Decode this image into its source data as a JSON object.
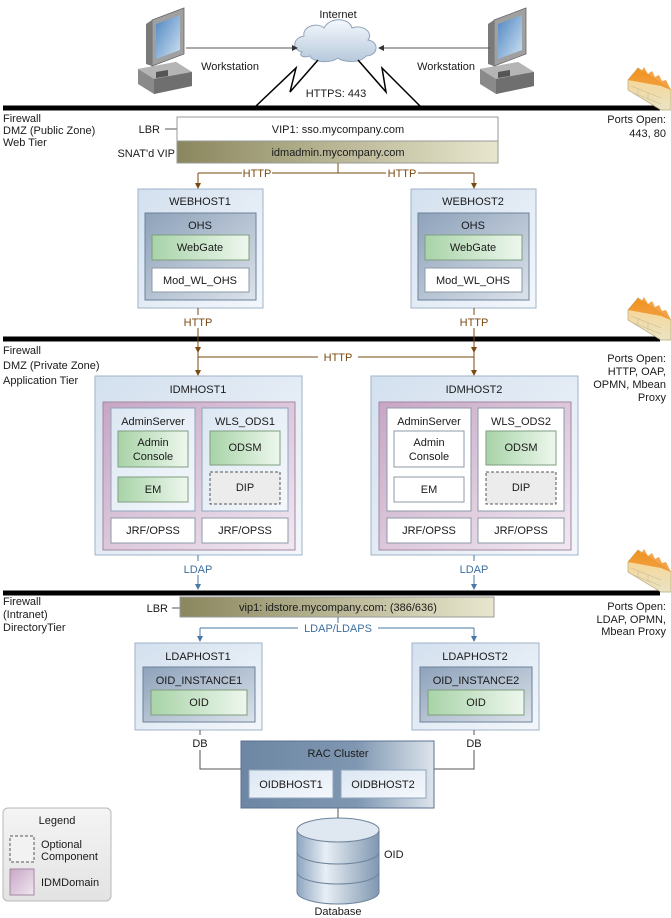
{
  "top": {
    "internet": "Internet",
    "workstation_left": "Workstation",
    "workstation_right": "Workstation",
    "https": "HTTPS: 443"
  },
  "zones": {
    "web": {
      "lines": [
        "Firewall",
        "DMZ (Public Zone)",
        "Web Tier"
      ],
      "ports": [
        "Ports Open:",
        "443, 80"
      ]
    },
    "app": {
      "lines": [
        "Firewall",
        "DMZ (Private Zone)",
        "Application Tier"
      ],
      "ports": [
        "Ports Open:",
        "HTTP, OAP,",
        "OPMN, Mbean",
        "Proxy"
      ]
    },
    "dir": {
      "lines": [
        "Firewall",
        "(Intranet)",
        "DirectoryTier"
      ],
      "ports": [
        "Ports Open:",
        "LDAP, OPMN,",
        "Mbean Proxy"
      ]
    }
  },
  "web_tier": {
    "lbr_label": "LBR",
    "vip1": "VIP1: sso.mycompany.com",
    "snat_label": "SNAT'd VIP",
    "snat_vip": "idmadmin.mycompany.com",
    "http": "HTTP",
    "hosts": [
      {
        "name": "WEBHOST1",
        "ohs": "OHS",
        "webgate": "WebGate",
        "mod": "Mod_WL_OHS"
      },
      {
        "name": "WEBHOST2",
        "ohs": "OHS",
        "webgate": "WebGate",
        "mod": "Mod_WL_OHS"
      }
    ]
  },
  "app_tier": {
    "http": "HTTP",
    "ldap": "LDAP",
    "hosts": [
      {
        "name": "IDMHOST1",
        "admin": "AdminServer",
        "admin_console": [
          "Admin",
          "Console"
        ],
        "em": "EM",
        "wls": "WLS_ODS1",
        "odsm": "ODSM",
        "dip": "DIP",
        "jrf1": "JRF/OPSS",
        "jrf2": "JRF/OPSS"
      },
      {
        "name": "IDMHOST2",
        "admin": "AdminServer",
        "admin_console": [
          "Admin",
          "Console"
        ],
        "em": "EM",
        "wls": "WLS_ODS2",
        "odsm": "ODSM",
        "dip": "DIP",
        "jrf1": "JRF/OPSS",
        "jrf2": "JRF/OPSS"
      }
    ]
  },
  "dir_tier": {
    "lbr_label": "LBR",
    "vip": "vip1: idstore.mycompany.com: (386/636)",
    "ldaps": "LDAP/LDAPS",
    "db": "DB",
    "hosts": [
      {
        "name": "LDAPHOST1",
        "instance": "OID_INSTANCE1",
        "oid": "OID"
      },
      {
        "name": "LDAPHOST2",
        "instance": "OID_INSTANCE2",
        "oid": "OID"
      }
    ],
    "rac": {
      "title": "RAC Cluster",
      "hosts": [
        "OIDBHOST1",
        "OIDBHOST2"
      ]
    },
    "database": {
      "oid": "OID",
      "label": "Database"
    }
  },
  "legend": {
    "title": "Legend",
    "optional": [
      "Optional",
      "Component"
    ],
    "domain": "IDMDomain"
  },
  "colors": {
    "http_line": "#7a4a12",
    "ldap_line": "#4a78a6",
    "component_green": "#b9dcb9",
    "idm_domain": "#d9bfd6",
    "host_blue": "#dbe6f1"
  },
  "icons": [
    "workstation-icon",
    "cloud-icon",
    "firewall-icon",
    "database-icon"
  ]
}
